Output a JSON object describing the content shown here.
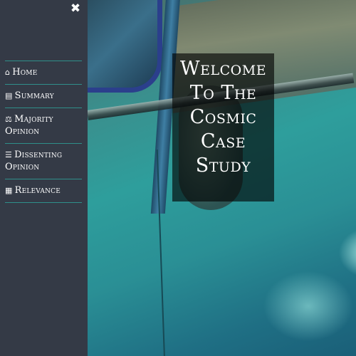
{
  "sidebar": {
    "close_label": "✖",
    "items": [
      {
        "icon": "⌂",
        "icon_name": "home-icon",
        "label": "Home"
      },
      {
        "icon": "▤",
        "icon_name": "book-icon",
        "label": "Summary"
      },
      {
        "icon": "⚖",
        "icon_name": "scale-icon",
        "label": "Majority Opinion"
      },
      {
        "icon": "☰",
        "icon_name": "document-icon",
        "label": "Dissenting Opinion"
      },
      {
        "icon": "▦",
        "icon_name": "grid-icon",
        "label": "Relevance"
      }
    ]
  },
  "hero": {
    "lines": [
      "Welcome",
      "To The",
      "Cosmic",
      "Case",
      "Study"
    ]
  },
  "colors": {
    "sidebar_bg": "#343a46",
    "divider": "#2f8f8a",
    "banner_bg": "rgba(0,0,0,0.62)"
  }
}
